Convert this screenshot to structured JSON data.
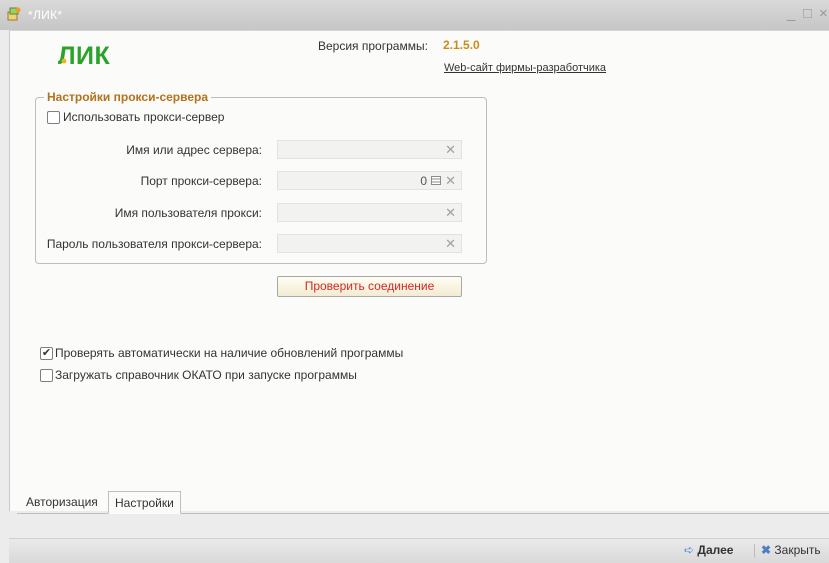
{
  "window": {
    "title": "*ЛИК*",
    "minimize_glyph": "_",
    "maximize_glyph": "□",
    "close_glyph": "×"
  },
  "header": {
    "logo_text": "ЛИК",
    "version_label": "Версия программы:",
    "version_value": "2.1.5.0",
    "developer_link": "Web-сайт фирмы-разработчика"
  },
  "proxy": {
    "group_title": "Настройки прокси-сервера",
    "use_proxy_label": "Использовать прокси-сервер",
    "use_proxy_checked": false,
    "fields": [
      {
        "label": "Имя или адрес сервера:",
        "value": ""
      },
      {
        "label": "Порт прокси-сервера:",
        "value": "0"
      },
      {
        "label": "Имя пользователя прокси:",
        "value": ""
      },
      {
        "label": "Пароль пользователя прокси-сервера:",
        "value": ""
      }
    ],
    "check_button": "Проверить соединение"
  },
  "options": {
    "auto_update_label": "Проверять автоматически на наличие обновлений программы",
    "auto_update_checked": true,
    "okato_label": "Загружать справочник ОКАТО при запуске программы",
    "okato_checked": false
  },
  "tabs": [
    {
      "label": "Авторизация",
      "active": false
    },
    {
      "label": "Настройки",
      "active": true
    }
  ],
  "statusbar": {
    "next_label": "Далее",
    "close_label": "Закрыть"
  },
  "colors": {
    "accent_orange": "#c98c1a",
    "logo_green": "#2aa32a",
    "button_text_red": "#d8261f",
    "group_title": "#b3721b"
  }
}
